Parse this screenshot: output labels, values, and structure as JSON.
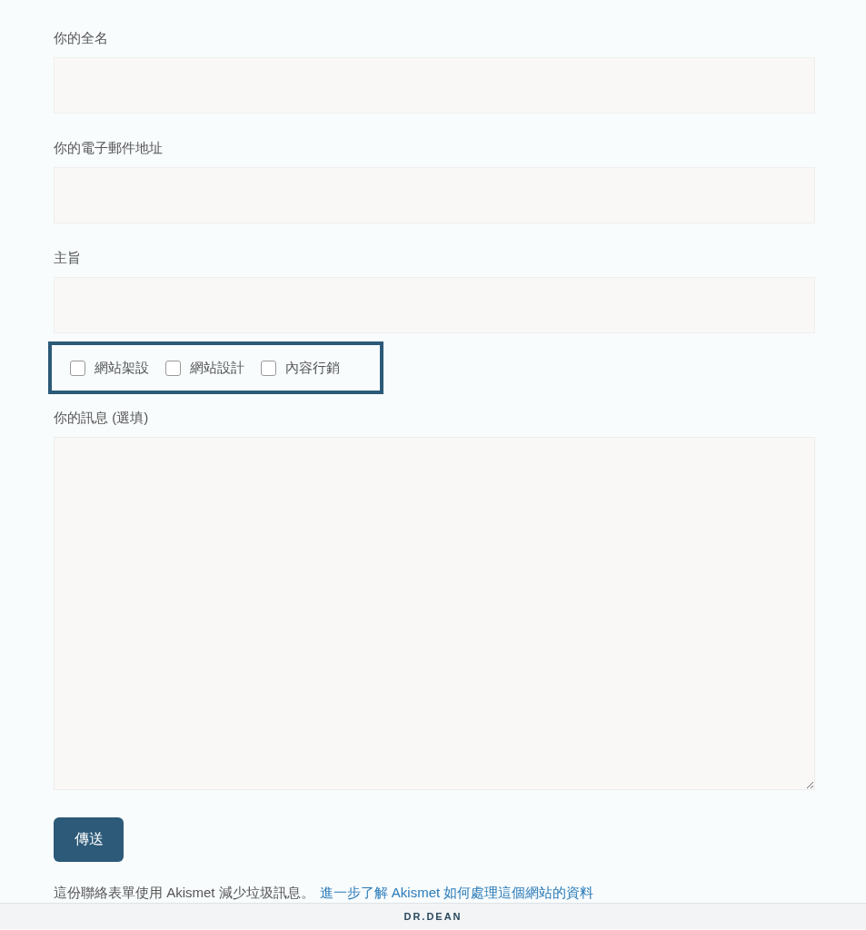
{
  "form": {
    "fields": [
      {
        "kind": "input",
        "label": "你的全名"
      },
      {
        "kind": "input",
        "label": "你的電子郵件地址"
      },
      {
        "kind": "input",
        "label": "主旨"
      },
      {
        "kind": "checkboxes",
        "options": [
          {
            "label": "網站架設",
            "checked": false
          },
          {
            "label": "網站設計",
            "checked": false
          },
          {
            "label": "內容行銷",
            "checked": false
          }
        ]
      },
      {
        "kind": "textarea",
        "label": "你的訊息 (選填)"
      }
    ],
    "submit": "傳送",
    "note": {
      "text": "這份聯絡表單使用 Akismet 減少垃圾訊息。",
      "link": "進一步了解 Akismet 如何處理這個網站的資料"
    }
  },
  "footer": {
    "logo": "DR.DEAN"
  }
}
